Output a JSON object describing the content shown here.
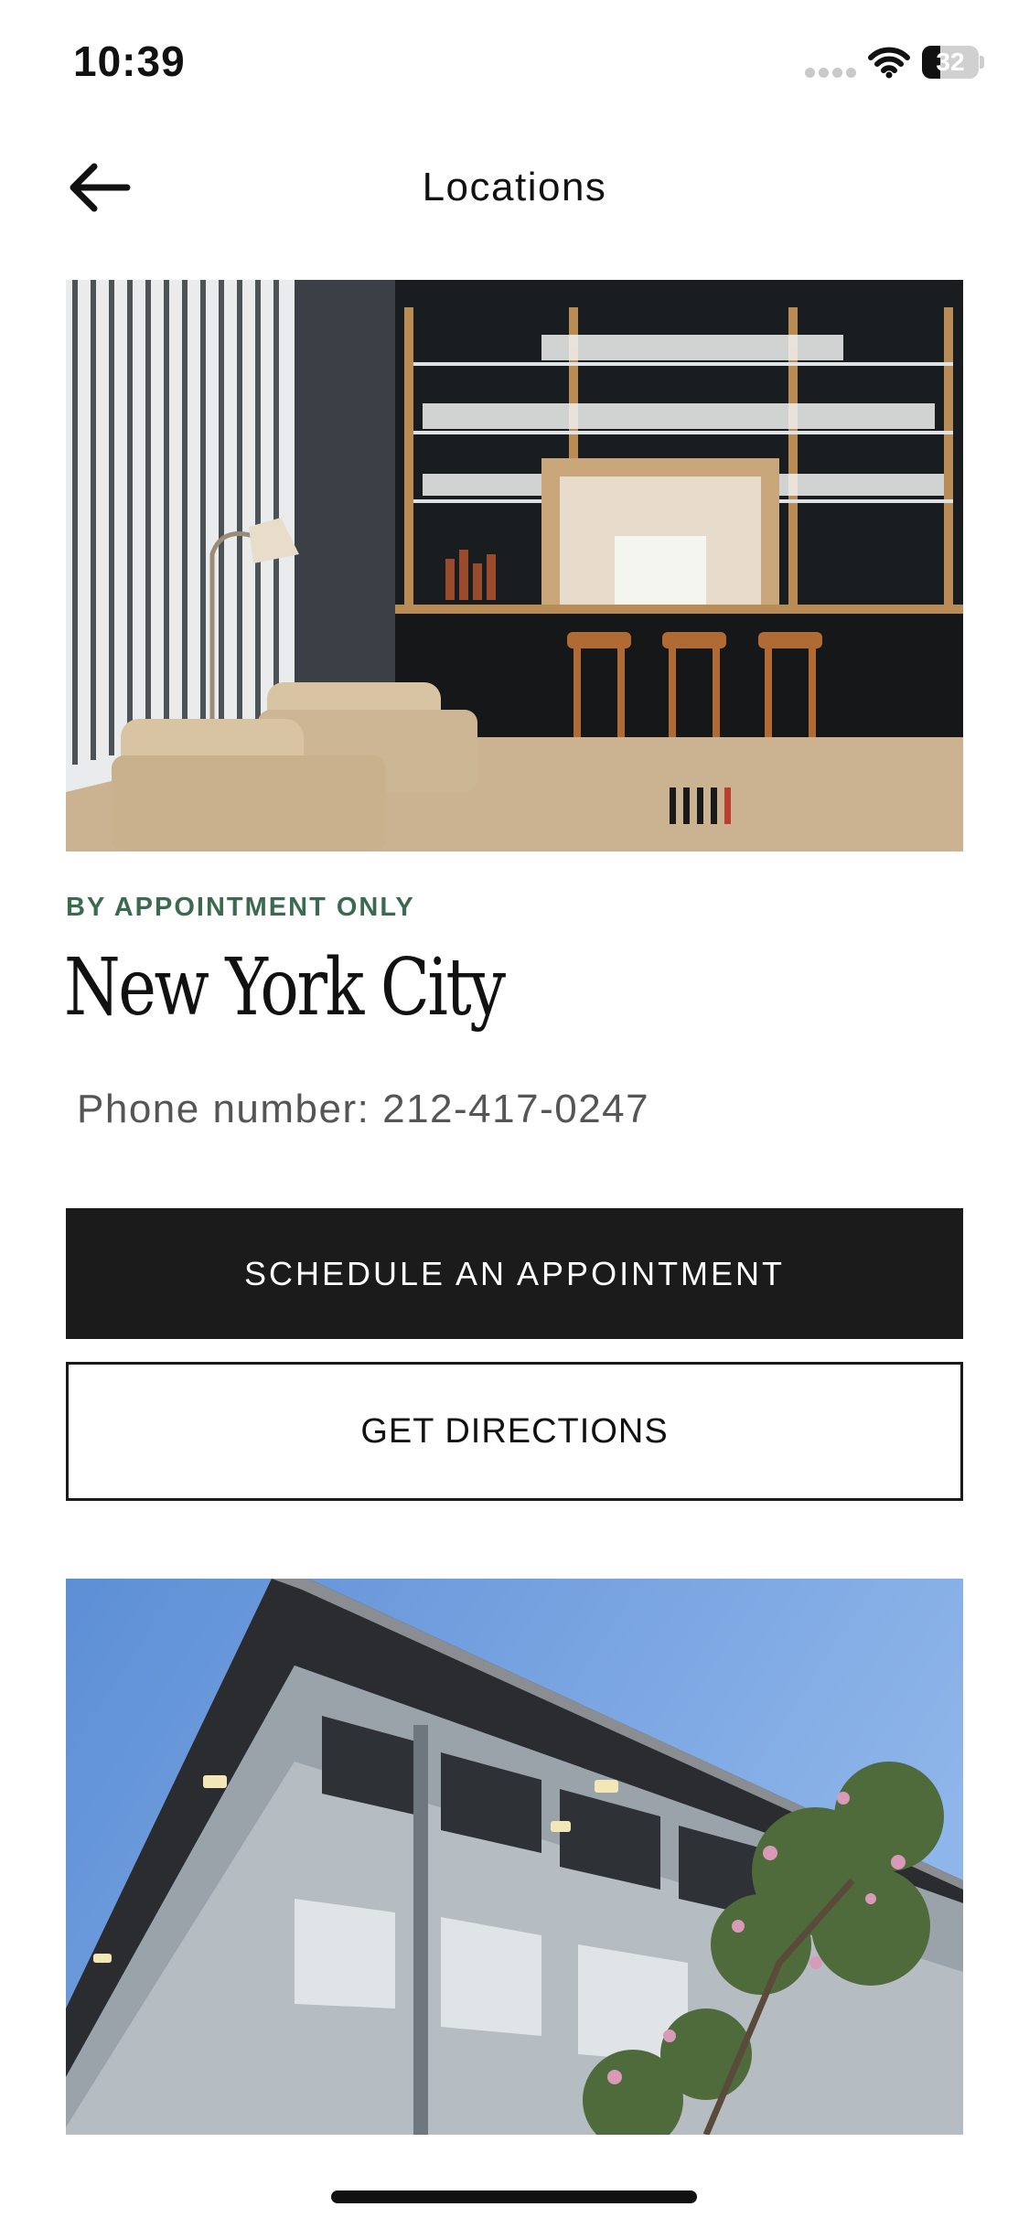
{
  "status_bar": {
    "time": "10:39",
    "battery_percent": "32",
    "battery_level": 0.32
  },
  "nav": {
    "title": "Locations",
    "back_icon": "arrow-left-icon"
  },
  "location": {
    "tag": "BY APPOINTMENT ONLY",
    "city": "New York City",
    "phone_label": "Phone number:",
    "phone_value": "212-417-0247"
  },
  "actions": {
    "schedule_label": "SCHEDULE AN APPOINTMENT",
    "directions_label": "GET DIRECTIONS"
  },
  "colors": {
    "accent_green": "#3a6b4e",
    "primary_button": "#1c1b1c",
    "background": "#ffffff"
  }
}
